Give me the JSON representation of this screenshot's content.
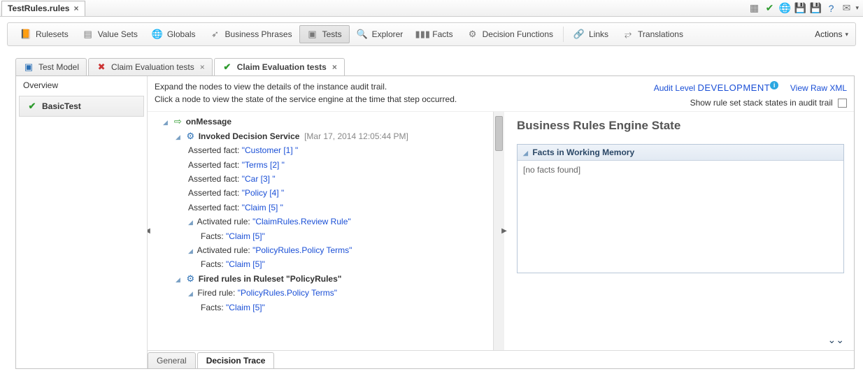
{
  "file_tab": {
    "label": "TestRules.rules"
  },
  "titlebar_icons": [
    "grid-icon",
    "check-icon",
    "globe-refresh-icon",
    "save-icon",
    "save-all-icon",
    "help-icon",
    "mail-icon"
  ],
  "toolbar": {
    "items": [
      {
        "icon": "rulesets-icon",
        "label": "Rulesets"
      },
      {
        "icon": "valuesets-icon",
        "label": "Value Sets"
      },
      {
        "icon": "globals-icon",
        "label": "Globals"
      },
      {
        "icon": "phrases-icon",
        "label": "Business Phrases"
      },
      {
        "icon": "tests-icon",
        "label": "Tests",
        "active": true
      },
      {
        "icon": "explorer-icon",
        "label": "Explorer"
      },
      {
        "icon": "facts-icon",
        "label": "Facts"
      },
      {
        "icon": "decisionfn-icon",
        "label": "Decision Functions"
      },
      {
        "icon": "links-icon",
        "label": "Links"
      },
      {
        "icon": "translations-icon",
        "label": "Translations"
      }
    ],
    "actions_label": "Actions"
  },
  "subtabs": [
    {
      "icon": "model-icon",
      "label": "Test Model",
      "closeable": false
    },
    {
      "icon": "fail-icon",
      "label": "Claim Evaluation tests",
      "closeable": true
    },
    {
      "icon": "pass-icon",
      "label": "Claim Evaluation tests",
      "closeable": true,
      "active": true
    }
  ],
  "leftnav": {
    "overview_label": "Overview",
    "tests": [
      {
        "status": "pass",
        "label": "BasicTest"
      }
    ]
  },
  "hints": {
    "line1": "Expand the nodes to view the details of the instance audit trail.",
    "line2": "Click a node to view the state of the service engine at the time that step occurred.",
    "audit_label": "Audit Level",
    "audit_value": "DEVELOPMENT",
    "raw_xml": "View Raw XML",
    "show_stack": "Show rule set stack states in audit trail"
  },
  "tree": {
    "root": "onMessage",
    "invoked": {
      "label": "Invoked Decision Service",
      "ts": "[Mar 17, 2014 12:05:44 PM]"
    },
    "asserts": [
      {
        "k": "Asserted fact:",
        "v": "\"Customer [1] \""
      },
      {
        "k": "Asserted fact:",
        "v": "\"Terms [2] \""
      },
      {
        "k": "Asserted fact:",
        "v": "\"Car [3] \""
      },
      {
        "k": "Asserted fact:",
        "v": "\"Policy [4] \""
      },
      {
        "k": "Asserted fact:",
        "v": "\"Claim [5] \""
      }
    ],
    "activated": [
      {
        "k": "Activated rule:",
        "v": "\"ClaimRules.Review Rule\"",
        "facts": "\"Claim [5]\""
      },
      {
        "k": "Activated rule:",
        "v": "\"PolicyRules.Policy Terms\"",
        "facts": "\"Claim [5]\""
      }
    ],
    "facts_label": "Facts:",
    "fired_header": "Fired rules in Ruleset  \"PolicyRules\"",
    "fired": [
      {
        "k": "Fired rule:",
        "v": "\"PolicyRules.Policy Terms\"",
        "facts": "\"Claim [5]\""
      }
    ]
  },
  "state": {
    "title": "Business Rules Engine State",
    "facts_header": "Facts in Working Memory",
    "facts_empty": "[no facts found]"
  },
  "bottom_tabs": {
    "general": "General",
    "trace": "Decision Trace"
  }
}
